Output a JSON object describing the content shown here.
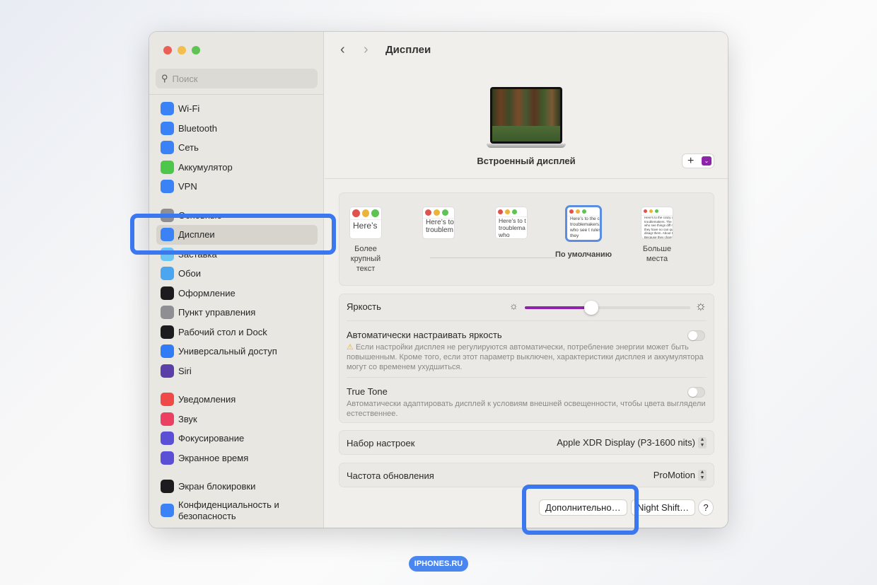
{
  "sidebar": {
    "search_placeholder": "Поиск",
    "groups": [
      [
        {
          "label": "Wi-Fi",
          "icon": "wifi-icon",
          "color": "#3b82f6"
        },
        {
          "label": "Bluetooth",
          "icon": "bluetooth-icon",
          "color": "#3b82f6"
        },
        {
          "label": "Сеть",
          "icon": "globe-icon",
          "color": "#3b82f6"
        },
        {
          "label": "Аккумулятор",
          "icon": "battery-icon",
          "color": "#4cc74a"
        },
        {
          "label": "VPN",
          "icon": "vpn-globe-icon",
          "color": "#3b82f6"
        }
      ],
      [
        {
          "label": "Основные",
          "icon": "gear-icon",
          "color": "#8e8e93"
        },
        {
          "label": "Дисплеи",
          "icon": "display-sun-icon",
          "color": "#3b82f6",
          "selected": true
        },
        {
          "label": "Заставка",
          "icon": "screensaver-icon",
          "color": "#6cc6f4"
        },
        {
          "label": "Обои",
          "icon": "wallpaper-icon",
          "color": "#4aa6f0"
        },
        {
          "label": "Оформление",
          "icon": "appearance-icon",
          "color": "#1c1c1e"
        },
        {
          "label": "Пункт управления",
          "icon": "control-center-icon",
          "color": "#8e8e93"
        },
        {
          "label": "Рабочий стол и Dock",
          "icon": "dock-icon",
          "color": "#1c1c1e"
        },
        {
          "label": "Универсальный доступ",
          "icon": "accessibility-icon",
          "color": "#2f7cf6"
        },
        {
          "label": "Siri",
          "icon": "siri-icon",
          "color": "#5b3fa8"
        }
      ],
      [
        {
          "label": "Уведомления",
          "icon": "bell-icon",
          "color": "#ef4a48"
        },
        {
          "label": "Звук",
          "icon": "speaker-icon",
          "color": "#ec4063"
        },
        {
          "label": "Фокусирование",
          "icon": "moon-icon",
          "color": "#5b4fd6"
        },
        {
          "label": "Экранное время",
          "icon": "hourglass-icon",
          "color": "#5b4fd6"
        }
      ],
      [
        {
          "label": "Экран блокировки",
          "icon": "lock-icon",
          "color": "#1c1c1e"
        },
        {
          "label": "Конфиденциальность и безопасность",
          "icon": "hand-icon",
          "color": "#3b82f6"
        }
      ]
    ]
  },
  "header": {
    "title": "Дисплеи"
  },
  "display": {
    "name": "Встроенный дисплей",
    "add": "+"
  },
  "resolution": {
    "options": [
      {
        "label": "Более крупный текст",
        "sample": "Here’s"
      },
      {
        "label": "",
        "sample": "Here’s to troublem"
      },
      {
        "label": "",
        "sample": "Here’s to t troublema ones who"
      },
      {
        "label": "По умолчанию",
        "sample": "Here’s to the cr troublemakers. ones who see t rules. And they"
      },
      {
        "label": "Больше места",
        "sample": "Here's to the crazy ones troublemakers. The round ones who see things diff rules. And they have no can quote them, disagr them. About the only th Because they change th"
      }
    ],
    "selected_index": 3
  },
  "brightness": {
    "label": "Яркость",
    "value": 0.4
  },
  "auto_brightness": {
    "label": "Автоматически настраивать яркость",
    "warning": "Если настройки дисплея не регулируются автоматически, потребление энергии может быть повышенным. Кроме того, если этот параметр выключен, характеристики дисплея и аккумулятора могут со временем ухудшиться.",
    "enabled": false
  },
  "true_tone": {
    "label": "True Tone",
    "description": "Автоматически адаптировать дисплей к условиям внешней освещенности, чтобы цвета выглядели естественнее.",
    "enabled": false
  },
  "preset": {
    "label": "Набор настроек",
    "value": "Apple XDR Display (P3-1600 nits)"
  },
  "refresh": {
    "label": "Частота обновления",
    "value": "ProMotion"
  },
  "buttons": {
    "advanced": "Дополнительно…",
    "night_shift": "Night Shift…",
    "help": "?"
  },
  "watermark": "IPHONES.RU",
  "colors": {
    "highlight": "#3b78f0",
    "slider": "#8e24aa"
  }
}
